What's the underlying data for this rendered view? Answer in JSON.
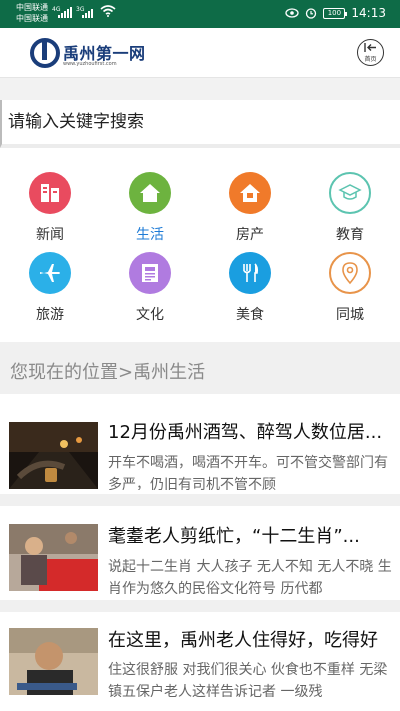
{
  "status_bar": {
    "carrier1": "中国联通",
    "carrier2": "中国联通",
    "net1": "4G",
    "net2": "3G",
    "battery": "100",
    "time": "14:13"
  },
  "header": {
    "logo_text": "禹州第一网",
    "logo_url": "www.yuzhoufirst.com",
    "home_label": "首页"
  },
  "search": {
    "placeholder": "请输入关键字搜索"
  },
  "categories": [
    {
      "label": "新闻",
      "color": "#e94b5f",
      "icon": "news-icon"
    },
    {
      "label": "生活",
      "color": "#6db33f",
      "icon": "house-icon"
    },
    {
      "label": "房产",
      "color": "#f07a2a",
      "icon": "building-icon"
    },
    {
      "label": "教育",
      "color": "#5cc4b0",
      "icon": "graduation-cap-icon"
    },
    {
      "label": "旅游",
      "color": "#2bb0e8",
      "icon": "airplane-icon"
    },
    {
      "label": "文化",
      "color": "#b07be0",
      "icon": "newspaper-icon"
    },
    {
      "label": "美食",
      "color": "#1a9ee0",
      "icon": "fork-knife-icon"
    },
    {
      "label": "同城",
      "color": "#e8944a",
      "icon": "location-pin-icon"
    }
  ],
  "breadcrumb": "您现在的位置>禹州生活",
  "news": [
    {
      "title": "12月份禹州酒驾、醉驾人数位居...",
      "desc": "开车不喝酒，喝酒不开车。可不管交警部门有多严，仍旧有司机不管不顾"
    },
    {
      "title": "耄耋老人剪纸忙，“十二生肖”...",
      "desc": "说起十二生肖 大人孩子 无人不知 无人不晓 生肖作为悠久的民俗文化符号 历代都"
    },
    {
      "title": "在这里，禹州老人住得好，吃得好",
      "desc": "住这很舒服 对我们很关心 伙食也不重样 无梁镇五保户老人这样告诉记者 一级残"
    }
  ]
}
